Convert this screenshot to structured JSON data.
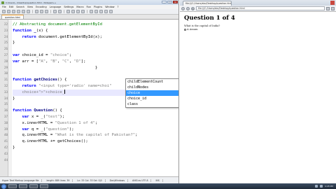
{
  "editor": {
    "window_title": "C:\\Users\\...\\Desktop\\question.html - Notepad++",
    "menu": [
      "File",
      "Edit",
      "Search",
      "View",
      "Encoding",
      "Language",
      "Settings",
      "Macro",
      "Run",
      "Plugins",
      "Window",
      "?"
    ],
    "tab_label": "question.html",
    "lines": [
      {
        "n": "22",
        "html": "<span class=\"c\">// Abstracting document.getElementById</span>"
      },
      {
        "n": "23",
        "html": "<span class=\"k\">function</span> <span class=\"p\">_</span>(x) {"
      },
      {
        "n": "24",
        "html": "    <span class=\"k\">return</span> document.getElementById(x);"
      },
      {
        "n": "25",
        "html": "}"
      },
      {
        "n": "26",
        "html": ""
      },
      {
        "n": "27",
        "html": "<span class=\"k\">var</span> choice_id = <span class=\"s\">\"choice\"</span>;"
      },
      {
        "n": "28",
        "html": "<span class=\"k\">var</span> arr = [<span class=\"s\">\"A\"</span>, <span class=\"s\">\"B\"</span>, <span class=\"s\">\"C\"</span>, <span class=\"s\">\"D\"</span>];"
      },
      {
        "n": "29",
        "html": "                                   }"
      },
      {
        "n": "30",
        "html": ""
      },
      {
        "n": "31",
        "html": "<span class=\"k\">function</span> <span class=\"p\">getChoices</span>() {"
      },
      {
        "n": "32",
        "html": "    <span class=\"k\">return</span> <span class=\"s\">\"&lt;input type='radio' name=choi\"</span>"
      },
      {
        "n": "33",
        "html": "    <span class=\"s\">choice+\"&gt;\"+choice_</span>"
      },
      {
        "n": "34",
        "html": "}"
      },
      {
        "n": "35",
        "html": ""
      },
      {
        "n": "36",
        "html": "<span class=\"k\">function</span> <span class=\"p\">Question</span>() {"
      },
      {
        "n": "37",
        "html": "    <span class=\"k\">var</span> x = _(<span class=\"s\">\"test\"</span>);"
      },
      {
        "n": "38",
        "html": "    x.innerHTML = <span class=\"s\">\"Question 1 of 4\"</span>;"
      },
      {
        "n": "39",
        "html": "    <span class=\"k\">var</span> q = _(<span class=\"s\">\"question\"</span>);"
      },
      {
        "n": "40",
        "html": "    q.innerHTML = <span class=\"s\">\"What is the capital of Pakistan?\"</span>;"
      },
      {
        "n": "41",
        "html": "    q.innerHTML += getChoices();"
      },
      {
        "n": "42",
        "html": "}"
      },
      {
        "n": "43",
        "html": ""
      },
      {
        "n": "44",
        "html": ""
      }
    ],
    "current_line_index": 11,
    "autocomplete": [
      "childElementCount",
      "childNodes",
      "choice",
      "choice_id",
      "class"
    ],
    "autocomplete_selected": 2,
    "status": [
      "Hyper Text Markup Language file",
      "length: 889   lines: 39",
      "Ln: 33   Col: 33   Sel: 0|0",
      "Dos\\Windows",
      "ANSI as UTF-8",
      "INS"
    ]
  },
  "browser": {
    "tab_label": "file:///C:/Users/abc/Desktop/question.html",
    "url": "file:///C:/Users/abc/Desktop/question.html",
    "heading": "Question 1 of 4",
    "question_text": "What is the capital of India?",
    "choice_label": "A Assam"
  },
  "taskbar": {
    "time": "4:28 PM"
  }
}
